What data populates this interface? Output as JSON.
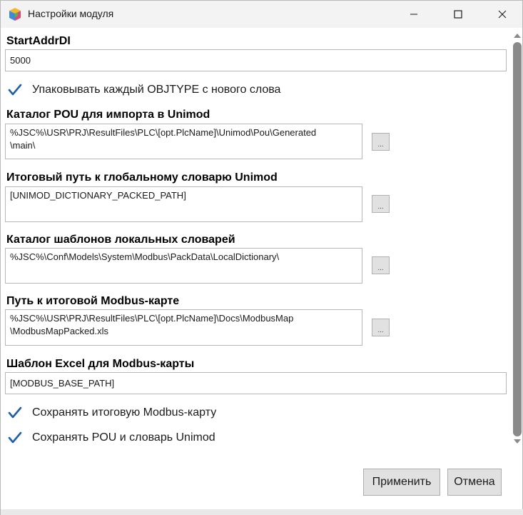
{
  "window": {
    "title": "Настройки модуля"
  },
  "fields": {
    "start_addr_di": {
      "label": "StartAddrDI",
      "value": "5000"
    },
    "pack_objtype": {
      "label": "Упаковывать каждый OBJTYPE с нового слова",
      "checked": true
    },
    "pou_catalog": {
      "label": "Каталог POU для импорта в Unimod",
      "value": "%JSC%\\USR\\PRJ\\ResultFiles\\PLC\\[opt.PlcName]\\Unimod\\Pou\\Generated\n\\main\\",
      "browse": "..."
    },
    "global_dict_path": {
      "label": "Итоговый путь к глобальному словарю Unimod",
      "value": "[UNIMOD_DICTIONARY_PACKED_PATH]",
      "browse": "..."
    },
    "local_dict_templates": {
      "label": "Каталог шаблонов локальных словарей",
      "value": "%JSC%\\Conf\\Models\\System\\Modbus\\PackData\\LocalDictionary\\",
      "browse": "..."
    },
    "modbus_map_path": {
      "label": "Путь к итоговой Modbus-карте",
      "value": "%JSC%\\USR\\PRJ\\ResultFiles\\PLC\\[opt.PlcName]\\Docs\\ModbusMap\n\\ModbusMapPacked.xls",
      "browse": "..."
    },
    "excel_template": {
      "label": "Шаблон Excel для Modbus-карты",
      "value": "[MODBUS_BASE_PATH]"
    },
    "save_modbus_map": {
      "label": "Сохранять итоговую Modbus-карту",
      "checked": true
    },
    "save_pou_dict": {
      "label": "Сохранять POU и словарь Unimod",
      "checked": true
    }
  },
  "buttons": {
    "apply": "Применить",
    "cancel": "Отмена"
  },
  "colors": {
    "check": "#1f5fa8",
    "titlebar": "#f3f3f3",
    "button_face": "#e1e1e1",
    "scroll_thumb": "#8a8a8a"
  },
  "icons": {
    "app": "app-cube-icon",
    "minimize": "minimize-icon",
    "maximize": "maximize-icon",
    "close": "close-icon",
    "check": "checkmark-icon"
  }
}
